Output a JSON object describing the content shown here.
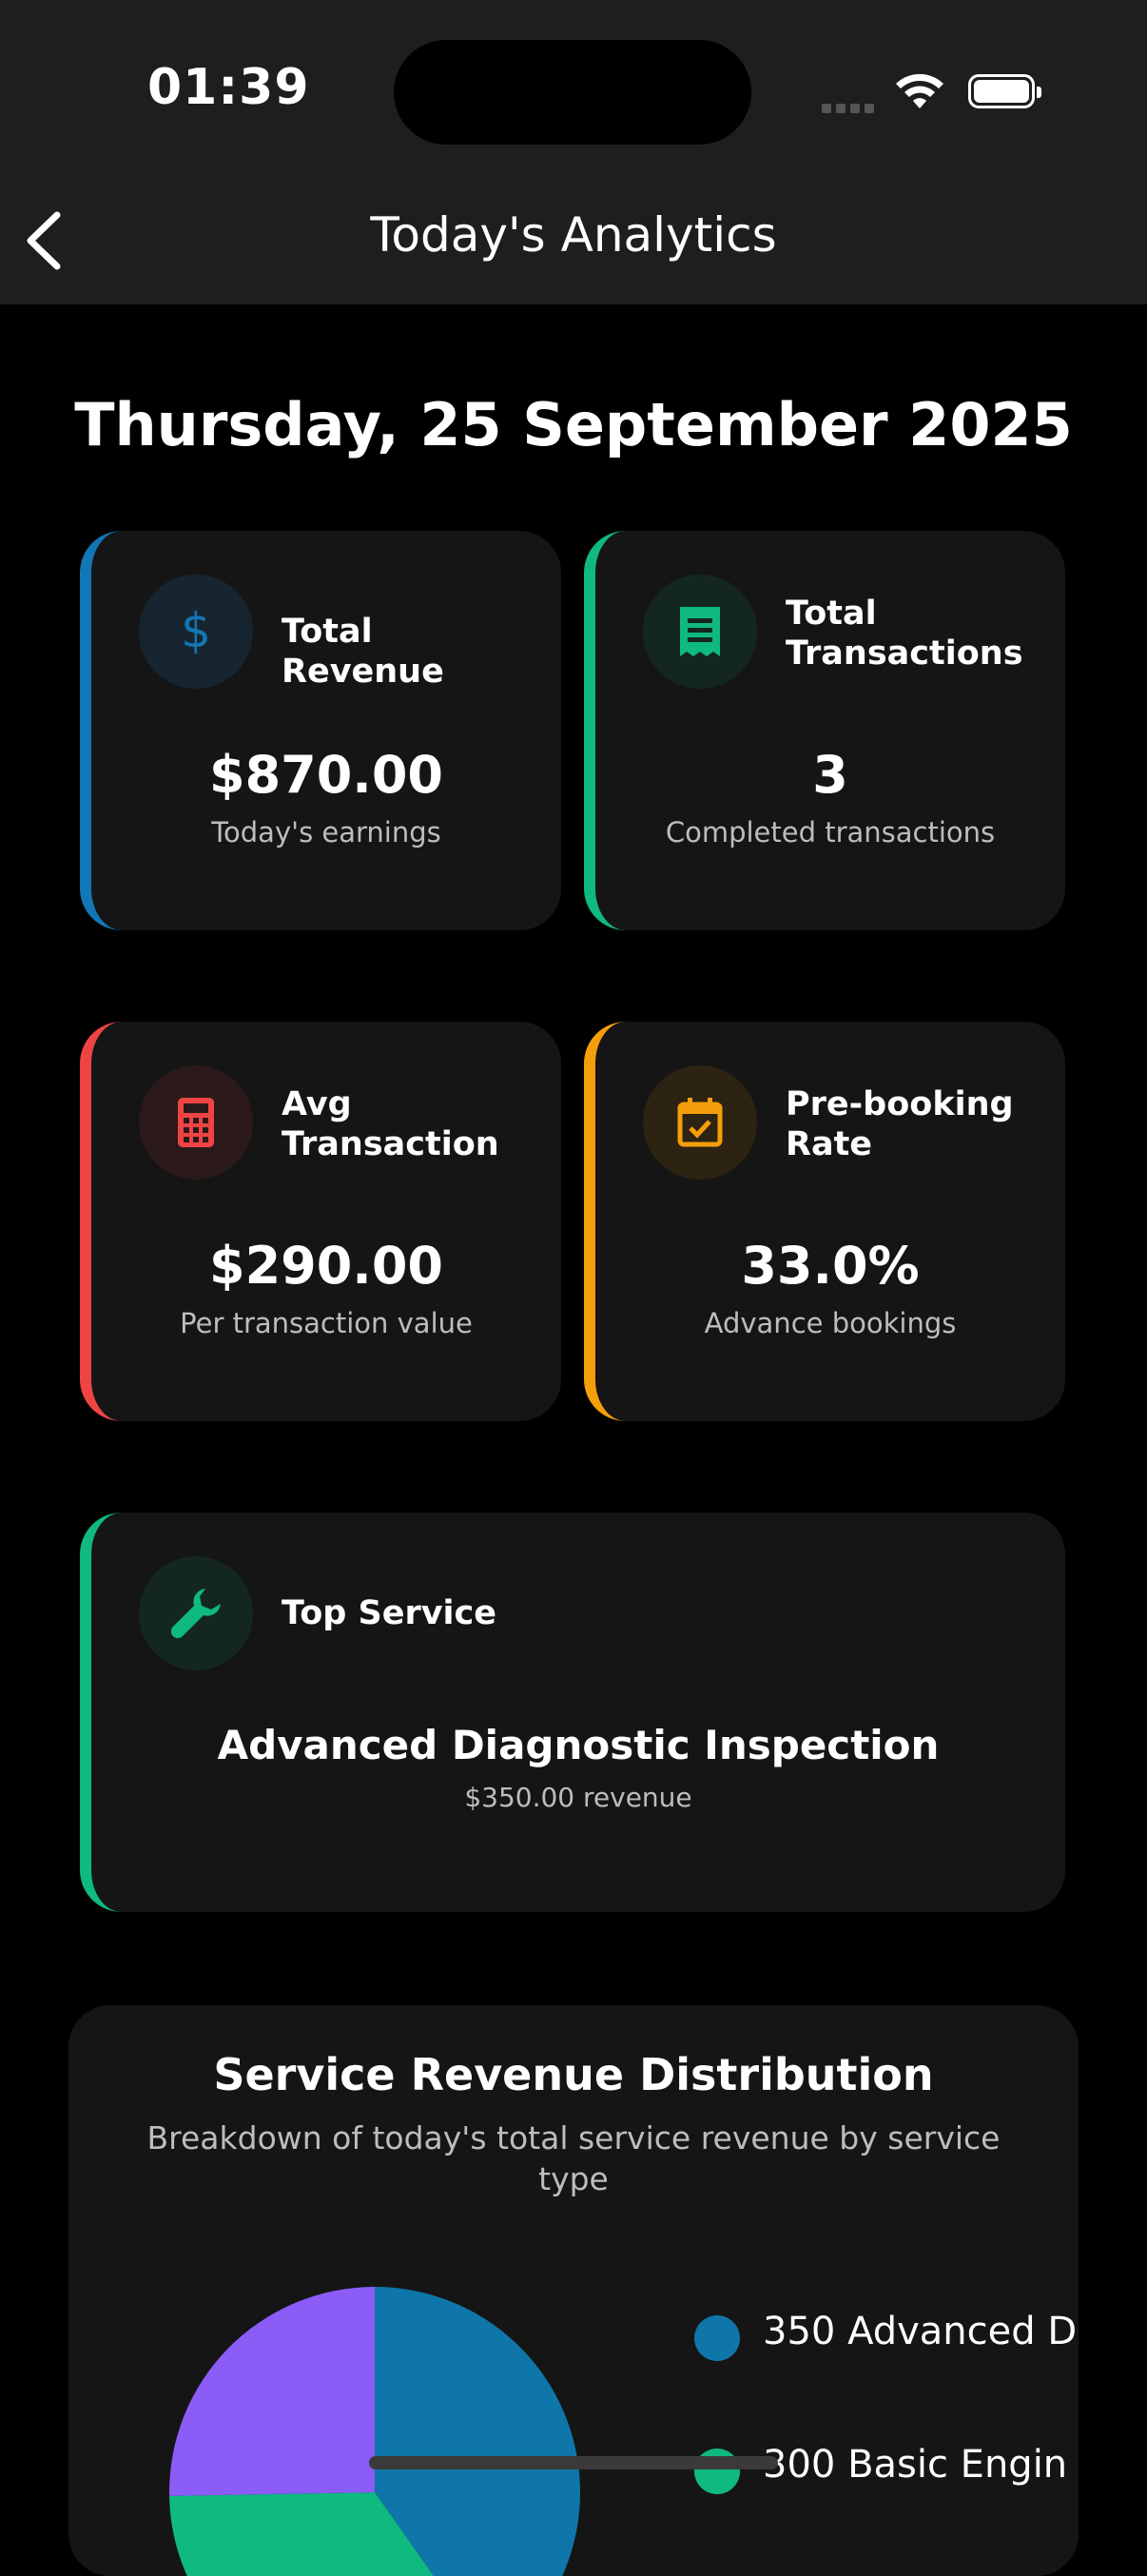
{
  "status_bar": {
    "time": "01:39"
  },
  "nav": {
    "title": "Today's Analytics"
  },
  "date": "Thursday, 25 September 2025",
  "stats": [
    {
      "label": "Total Revenue",
      "value": "$870.00",
      "caption": "Today's earnings",
      "accent": "#1376b5",
      "icon": "dollar-icon"
    },
    {
      "label": "Total Transactions",
      "value": "3",
      "caption": "Completed transactions",
      "accent": "#10b981",
      "icon": "receipt-icon"
    },
    {
      "label": "Avg Transaction",
      "value": "$290.00",
      "caption": "Per transaction value",
      "accent": "#ef4444",
      "icon": "calculator-icon"
    },
    {
      "label": "Pre-booking Rate",
      "value": "33.0%",
      "caption": "Advance bookings",
      "accent": "#f59e0b",
      "icon": "calendar-check-icon"
    }
  ],
  "top_service": {
    "label": "Top Service",
    "name": "Advanced Diagnostic Inspection",
    "revenue": "$350.00 revenue",
    "accent": "#10b981",
    "icon": "wrench-icon"
  },
  "chart_data": {
    "type": "pie",
    "title": "Service Revenue Distribution",
    "subtitle": "Breakdown of today's total service revenue by service type",
    "slices": [
      {
        "label": "350 Advanced D",
        "value": 350,
        "color": "#0e76a8"
      },
      {
        "label": "300 Basic Engin",
        "value": 300,
        "color": "#10b981"
      },
      {
        "label": "",
        "value": 220,
        "color": "#8b5cf6"
      }
    ]
  }
}
